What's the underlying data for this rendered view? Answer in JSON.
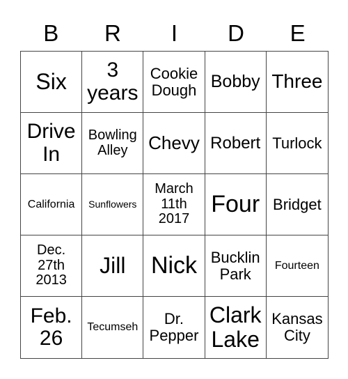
{
  "header": [
    "B",
    "R",
    "I",
    "D",
    "E"
  ],
  "cells": [
    [
      "Six",
      "3\nyears",
      "Cookie\nDough",
      "Bobby",
      "Three"
    ],
    [
      "Drive\nIn",
      "Bowling\nAlley",
      "Chevy",
      "Robert",
      "Turlock"
    ],
    [
      "California",
      "Sunflowers",
      "March\n11th\n2017",
      "Four",
      "Bridget"
    ],
    [
      "Dec.\n27th\n2013",
      "Jill",
      "Nick",
      "Bucklin\nPark",
      "Fourteen"
    ],
    [
      "Feb.\n26",
      "Tecumseh",
      "Dr.\nPepper",
      "Clark\nLake",
      "Kansas\nCity"
    ]
  ]
}
